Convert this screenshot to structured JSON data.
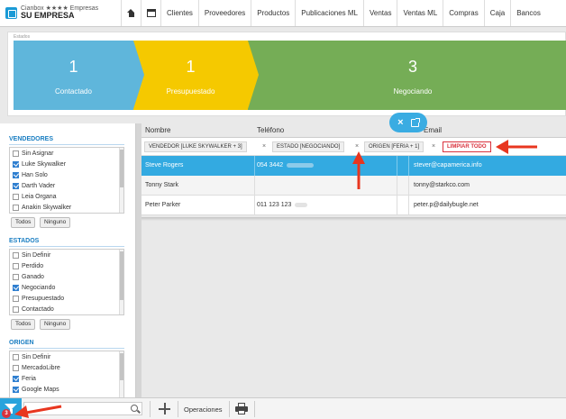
{
  "brand": {
    "line1": "Cianbox ★★★★ Empresas",
    "name": "SU EMPRESA"
  },
  "nav": [
    "Clientes",
    "Proveedores",
    "Productos",
    "Publicaciones ML",
    "Ventas",
    "Ventas ML",
    "Compras",
    "Caja",
    "Bancos"
  ],
  "pipeline": {
    "label": "Estados",
    "stages": [
      {
        "count": "1",
        "name": "Contactado",
        "color": "#5fb6db"
      },
      {
        "count": "1",
        "name": "Presupuestado",
        "color": "#f5c900"
      },
      {
        "count": "3",
        "name": "Negociando",
        "color": "#75ad56"
      }
    ]
  },
  "filters": {
    "vendedores": {
      "title": "VENDEDORES",
      "options": [
        {
          "label": "Sin Asignar",
          "checked": false
        },
        {
          "label": "Luke Skywalker",
          "checked": true
        },
        {
          "label": "Han Solo",
          "checked": true
        },
        {
          "label": "Darth Vader",
          "checked": true
        },
        {
          "label": "Leia Organa",
          "checked": false
        },
        {
          "label": "Anakin Skywalker",
          "checked": false
        }
      ],
      "all_label": "Todos",
      "none_label": "Ninguno"
    },
    "estados": {
      "title": "ESTADOS",
      "options": [
        {
          "label": "Sin Definir",
          "checked": false
        },
        {
          "label": "Perdido",
          "checked": false
        },
        {
          "label": "Ganado",
          "checked": false
        },
        {
          "label": "Negociando",
          "checked": true
        },
        {
          "label": "Presupuestado",
          "checked": false
        },
        {
          "label": "Contactado",
          "checked": false
        }
      ],
      "all_label": "Todos",
      "none_label": "Ninguno"
    },
    "origen": {
      "title": "ORIGEN",
      "options": [
        {
          "label": "Sin Definir",
          "checked": false
        },
        {
          "label": "MercadoLibre",
          "checked": false
        },
        {
          "label": "Feria",
          "checked": true
        },
        {
          "label": "Google Maps",
          "checked": true
        }
      ]
    }
  },
  "table": {
    "headers": {
      "name": "Nombre",
      "phone": "Teléfono",
      "email": "Email"
    },
    "chips": [
      {
        "label": "VENDEDOR [LUKE SKYWALKER + 3]"
      },
      {
        "label": "ESTADO [NEGOCIANDO]"
      },
      {
        "label": "ORIGEN [FERIA + 1]"
      }
    ],
    "chip_remove": "×",
    "clear_all": "LIMPIAR TODO",
    "rows": [
      {
        "name": "Steve Rogers",
        "phone": "054 3442",
        "email": "stever@capamerica.info"
      },
      {
        "name": "Tonny Stark",
        "phone": "",
        "email": "tonny@starkco.com"
      },
      {
        "name": "Peter Parker",
        "phone": "011 123 123",
        "email": "peter.p@dailybugle.net"
      }
    ]
  },
  "bottom": {
    "badge": "3",
    "search_placeholder": "",
    "operations_label": "Operaciones"
  },
  "colors": {
    "accent": "#33aae1",
    "annotation": "#e8361f",
    "danger": "#d9323d"
  },
  "icons": [
    "home-icon",
    "calendar-icon",
    "close-icon",
    "expand-icon",
    "filter-icon",
    "search-icon",
    "plus-icon",
    "printer-icon"
  ]
}
